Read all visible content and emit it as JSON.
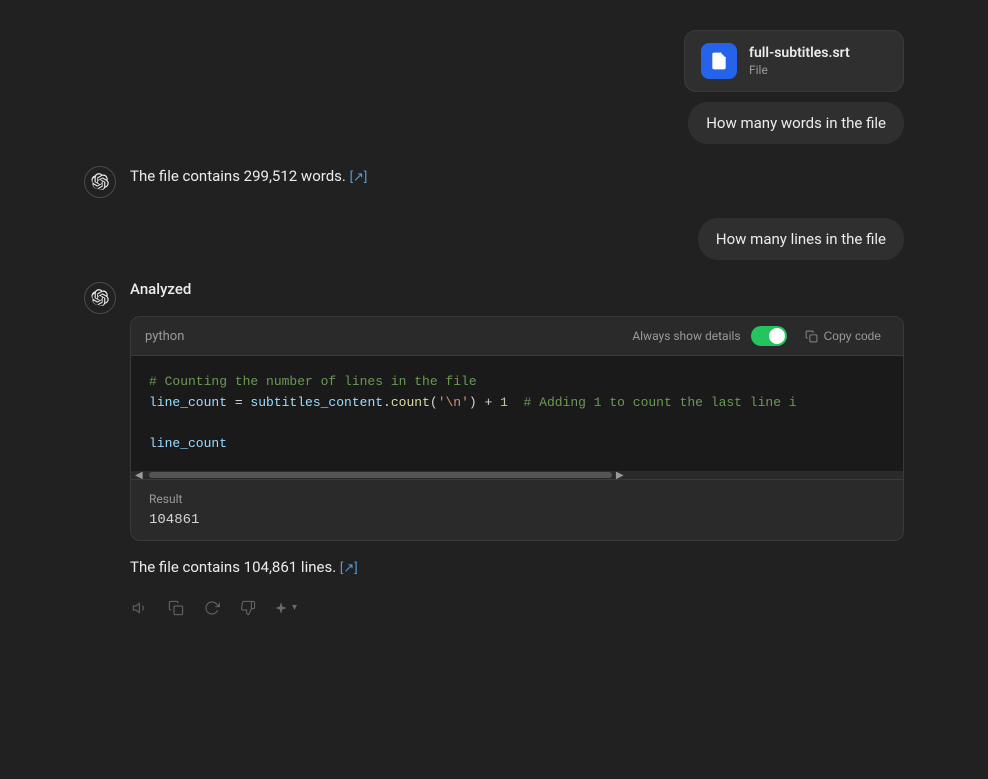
{
  "chat": {
    "userMessages": [
      {
        "id": "msg1",
        "file": {
          "name": "full-subtitles.srt",
          "type": "File"
        },
        "text": "How many words in the file"
      },
      {
        "id": "msg2",
        "text": "How many lines in the file"
      }
    ],
    "assistantMessages": [
      {
        "id": "resp1",
        "text": "The file contains 299,512 words.",
        "citation": "🔗"
      },
      {
        "id": "resp2",
        "analyzedLabel": "Analyzed",
        "codeBlock": {
          "language": "python",
          "alwaysShowLabel": "Always show details",
          "copyLabel": "Copy code",
          "lines": [
            {
              "type": "comment",
              "text": "# Counting the number of lines in the file"
            },
            {
              "type": "mixed",
              "text": "line_count = subtitles_content.count('\\n') + 1  # Adding 1 to count the last line i"
            },
            {
              "type": "blank",
              "text": ""
            },
            {
              "type": "plain",
              "text": "line_count"
            }
          ],
          "result": {
            "label": "Result",
            "value": "104861"
          }
        },
        "text": "The file contains 104,861 lines.",
        "citation": "🔗"
      }
    ]
  },
  "icons": {
    "copy": "copy-icon",
    "refresh": "refresh-icon",
    "thumbsDown": "thumbs-down-icon",
    "volume": "volume-icon",
    "sparkle": "sparkle-icon"
  }
}
